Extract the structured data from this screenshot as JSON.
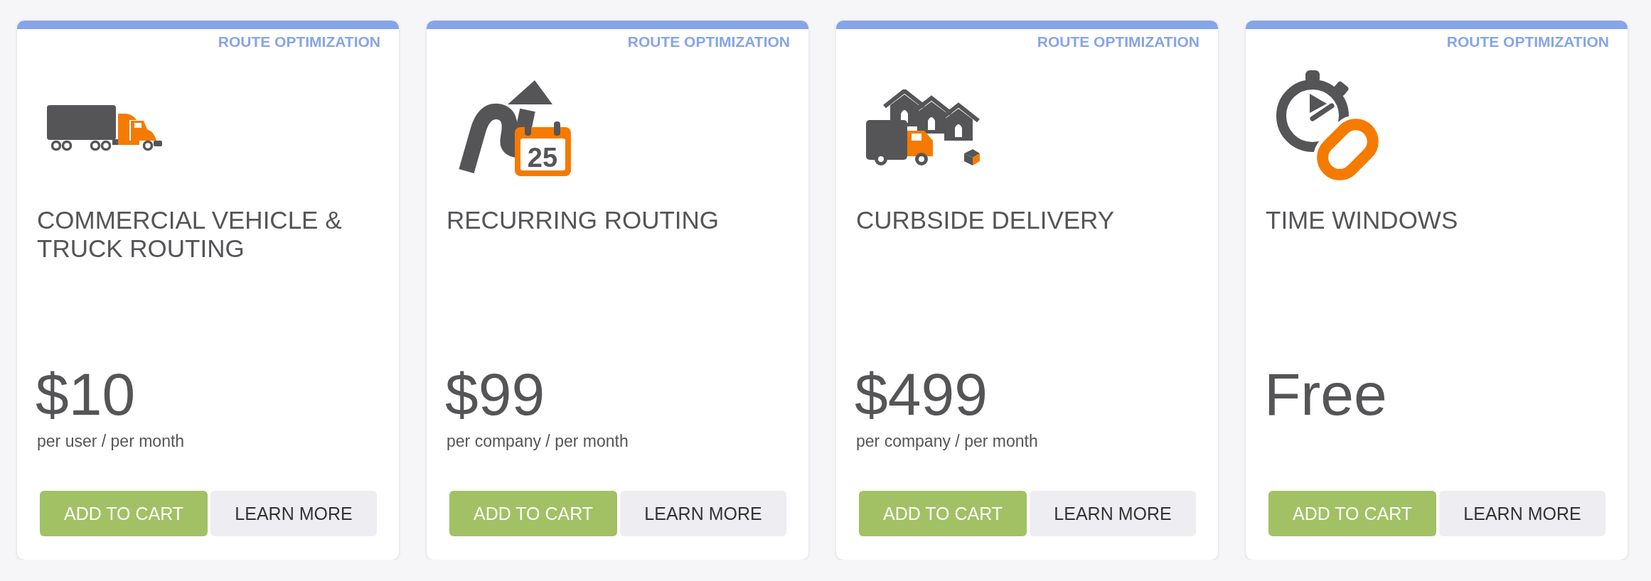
{
  "cards": [
    {
      "category": "ROUTE OPTIMIZATION",
      "icon": {
        "kind": "truck"
      },
      "title": "COMMERCIAL VEHICLE & TRUCK ROUTING",
      "price": "$10",
      "period": "per user / per month",
      "buttons": [
        {
          "kind": "primary",
          "label": "ADD TO CART"
        },
        {
          "kind": "secondary",
          "label": "LEARN MORE"
        }
      ]
    },
    {
      "category": "ROUTE OPTIMIZATION",
      "icon": {
        "kind": "route-calendar",
        "label": "25"
      },
      "title": "RECURRING ROUTING",
      "price": "$99",
      "period": "per company / per month",
      "buttons": [
        {
          "kind": "primary",
          "label": "ADD TO CART"
        },
        {
          "kind": "secondary",
          "label": "LEARN MORE"
        }
      ]
    },
    {
      "category": "ROUTE OPTIMIZATION",
      "icon": {
        "kind": "delivery"
      },
      "title": "CURBSIDE DELIVERY",
      "price": "$499",
      "period": "per company / per month",
      "buttons": [
        {
          "kind": "primary",
          "label": "ADD TO CART"
        },
        {
          "kind": "secondary",
          "label": "LEARN MORE"
        }
      ]
    },
    {
      "category": "ROUTE OPTIMIZATION",
      "icon": {
        "kind": "stopwatch-link"
      },
      "title": "TIME WINDOWS",
      "price": "Free",
      "buttons": [
        {
          "kind": "primary",
          "label": "ADD TO CART"
        },
        {
          "kind": "secondary",
          "label": "LEARN MORE"
        }
      ]
    }
  ]
}
